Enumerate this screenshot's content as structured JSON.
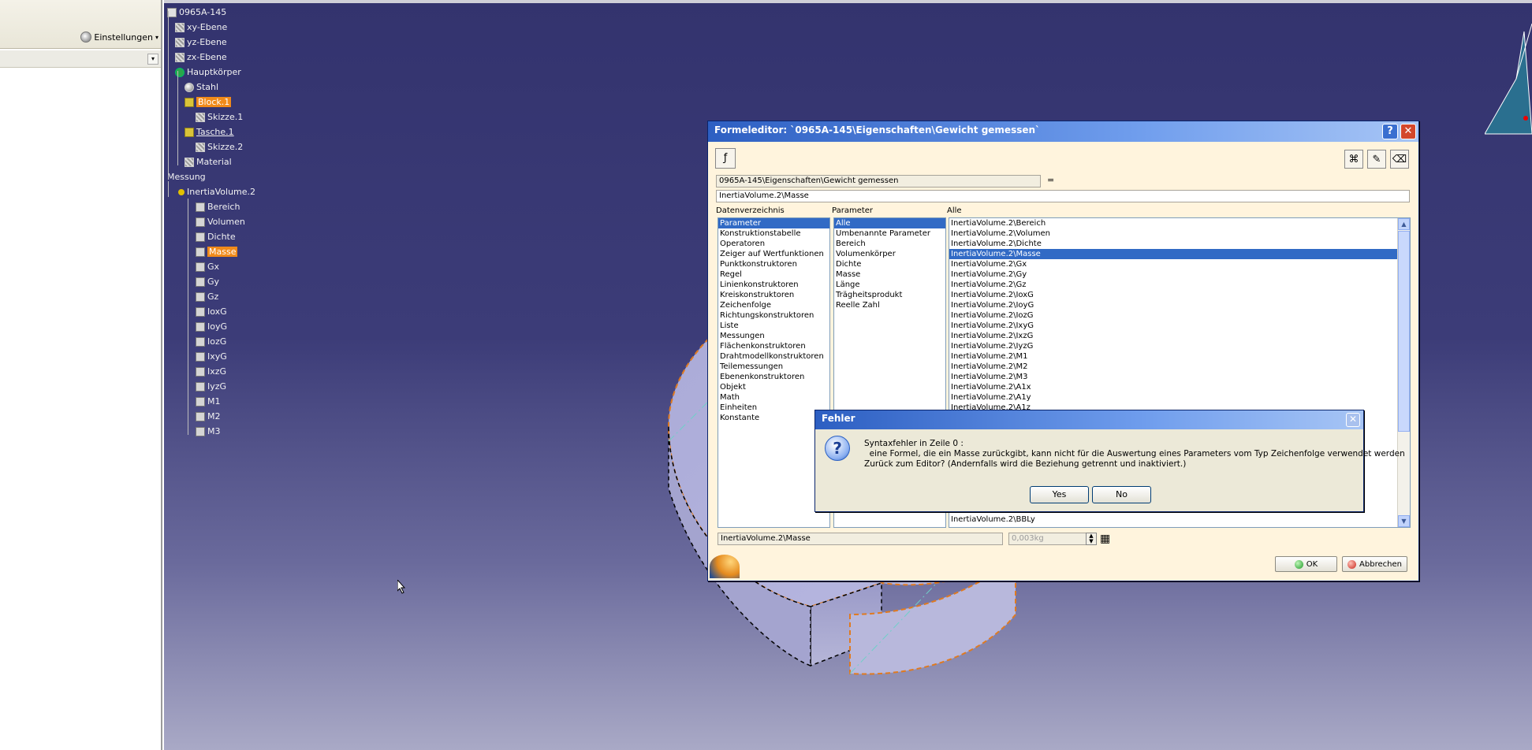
{
  "left_panel": {
    "settings_label": "Einstellungen",
    "dropdown_glyph": "▾"
  },
  "tree": {
    "root": "0965A-145",
    "planes": [
      "xy-Ebene",
      "yz-Ebene",
      "zx-Ebene"
    ],
    "body": "Hauptkörper",
    "material_applied": "Stahl",
    "block": "Block.1",
    "sketch1": "Skizze.1",
    "pocket": "Tasche.1",
    "sketch2": "Skizze.2",
    "material": "Material",
    "measure": "Messung",
    "inertia": "InertiaVolume.2",
    "params": [
      "Bereich",
      "Volumen",
      "Dichte",
      "Masse",
      "Gx",
      "Gy",
      "Gz",
      "IoxG",
      "IoyG",
      "IozG",
      "IxyG",
      "IxzG",
      "IyzG",
      "M1",
      "M2",
      "M3"
    ],
    "highlighted": "Masse"
  },
  "formel": {
    "title": "Formeleditor:  `0965A-145\\Eigenschaften\\Gewicht gemessen`",
    "help": "?",
    "close": "✕",
    "param_path": "0965A-145\\Eigenschaften\\Gewicht gemessen",
    "equals": "=",
    "formula": "InertiaVolume.2\\Masse",
    "col1_header": "Datenverzeichnis",
    "col2_header": "Parameter",
    "col3_header": "Alle",
    "col1_items": [
      "Parameter",
      "Konstruktionstabelle",
      "Operatoren",
      "Zeiger auf Wertfunktionen",
      "Punktkonstruktoren",
      "Regel",
      "Linienkonstruktoren",
      "Kreiskonstruktoren",
      "Zeichenfolge",
      "Richtungskonstruktoren",
      "Liste",
      "Messungen",
      "Flächenkonstruktoren",
      "Drahtmodellkonstruktoren",
      "Teilemessungen",
      "Ebenenkonstruktoren",
      "Objekt",
      "Math",
      "Einheiten",
      "Konstante"
    ],
    "col2_items": [
      "Alle",
      "Umbenannte Parameter",
      "Bereich",
      "Volumenkörper",
      "Dichte",
      "Masse",
      "Länge",
      "Trägheitsprodukt",
      "Reelle Zahl"
    ],
    "col3_items": [
      "InertiaVolume.2\\Bereich",
      "InertiaVolume.2\\Volumen",
      "InertiaVolume.2\\Dichte",
      "InertiaVolume.2\\Masse",
      "InertiaVolume.2\\Gx",
      "InertiaVolume.2\\Gy",
      "InertiaVolume.2\\Gz",
      "InertiaVolume.2\\IoxG",
      "InertiaVolume.2\\IoyG",
      "InertiaVolume.2\\IozG",
      "InertiaVolume.2\\IxyG",
      "InertiaVolume.2\\IxzG",
      "InertiaVolume.2\\IyzG",
      "InertiaVolume.2\\M1",
      "InertiaVolume.2\\M2",
      "InertiaVolume.2\\M3",
      "InertiaVolume.2\\A1x",
      "InertiaVolume.2\\A1y",
      "InertiaVolume.2\\A1z"
    ],
    "col3_last": "InertiaVolume.2\\BBLy",
    "bottom_field": "InertiaVolume.2\\Masse",
    "value_field": "0,003kg",
    "ok": "OK",
    "cancel": "Abbrechen"
  },
  "fehler": {
    "title": "Fehler",
    "close": "✕",
    "line1": "Syntaxfehler in Zeile 0 :",
    "line2": "  eine Formel, die ein Masse zurückgibt, kann nicht für die Auswertung eines Parameters vom Typ Zeichenfolge verwendet werden",
    "line3": "Zurück zum Editor? (Andernfalls wird die Beziehung getrennt und inaktiviert.)",
    "yes": "Yes",
    "no": "No"
  },
  "colors": {
    "viewport_top": "#33336e",
    "viewport_bottom": "#a9a9c6",
    "highlight": "#f08a1a",
    "selection": "#316ac5",
    "dialog_bg": "#fff4dd"
  },
  "icons": [
    "gear-icon",
    "question-icon",
    "close-icon",
    "ok-led-icon",
    "cancel-led-icon",
    "fx-icon",
    "cursor-icon"
  ]
}
